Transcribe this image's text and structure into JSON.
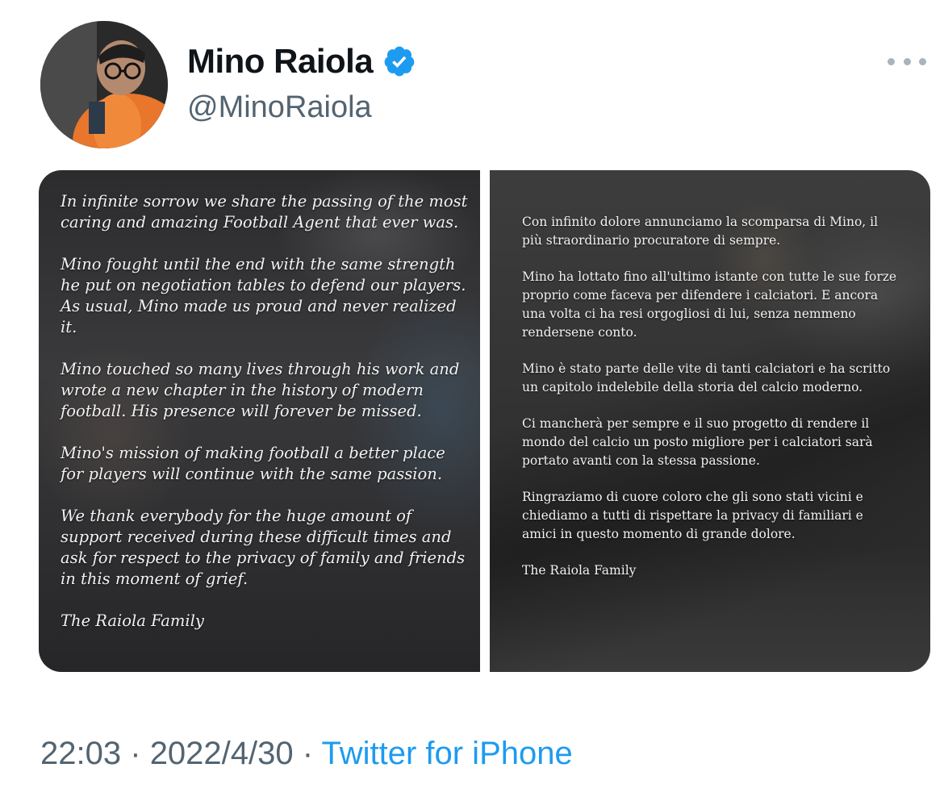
{
  "tweet": {
    "author": {
      "display_name": "Mino Raiola",
      "handle": "@MinoRaiola",
      "verified": true,
      "avatar_icon": "profile-photo"
    },
    "more_icon": "more-dots-icon",
    "media": {
      "left_letter": {
        "paragraphs": [
          "In infinite sorrow we share the passing of the most caring and amazing Football Agent that ever was.",
          "Mino fought until the end with the same strength he put on negotiation tables to defend our players. As usual, Mino made us proud and never realized it.",
          "Mino touched so many lives through his work and wrote a new chapter in the history of modern football. His presence will forever be missed.",
          "Mino's mission of making football a better place for players will continue with the same passion.",
          "We thank everybody for the huge amount of support received during these difficult times and ask for respect to the privacy of family and friends in this moment of grief.",
          "The Raiola Family"
        ]
      },
      "right_letter": {
        "paragraphs": [
          "Con infinito dolore annunciamo la scomparsa di Mino, il più straordinario procuratore di sempre.",
          "Mino ha lottato fino all'ultimo istante con tutte le sue forze proprio come faceva per difendere i calciatori. E ancora una volta ci ha resi orgogliosi di lui, senza nemmeno rendersene conto.",
          "Mino è stato parte delle vite di tanti calciatori e ha scritto un capitolo indelebile della storia del calcio moderno.",
          "Ci mancherà per sempre e il suo progetto di rendere il mondo del calcio un posto migliore per i calciatori sarà portato avanti con la stessa passione.",
          "Ringraziamo di cuore coloro che gli sono stati vicini e chiediamo a tutti di rispettare la privacy di familiari e amici in questo momento di grande dolore.",
          "The Raiola Family"
        ]
      }
    },
    "time": "22:03",
    "separator": "·",
    "date": "2022/4/30",
    "source": "Twitter for iPhone"
  },
  "colors": {
    "verified_blue": "#1d9bf0",
    "link_blue": "#1d9bf0",
    "secondary_text": "#536471",
    "primary_text": "#0f1419"
  }
}
